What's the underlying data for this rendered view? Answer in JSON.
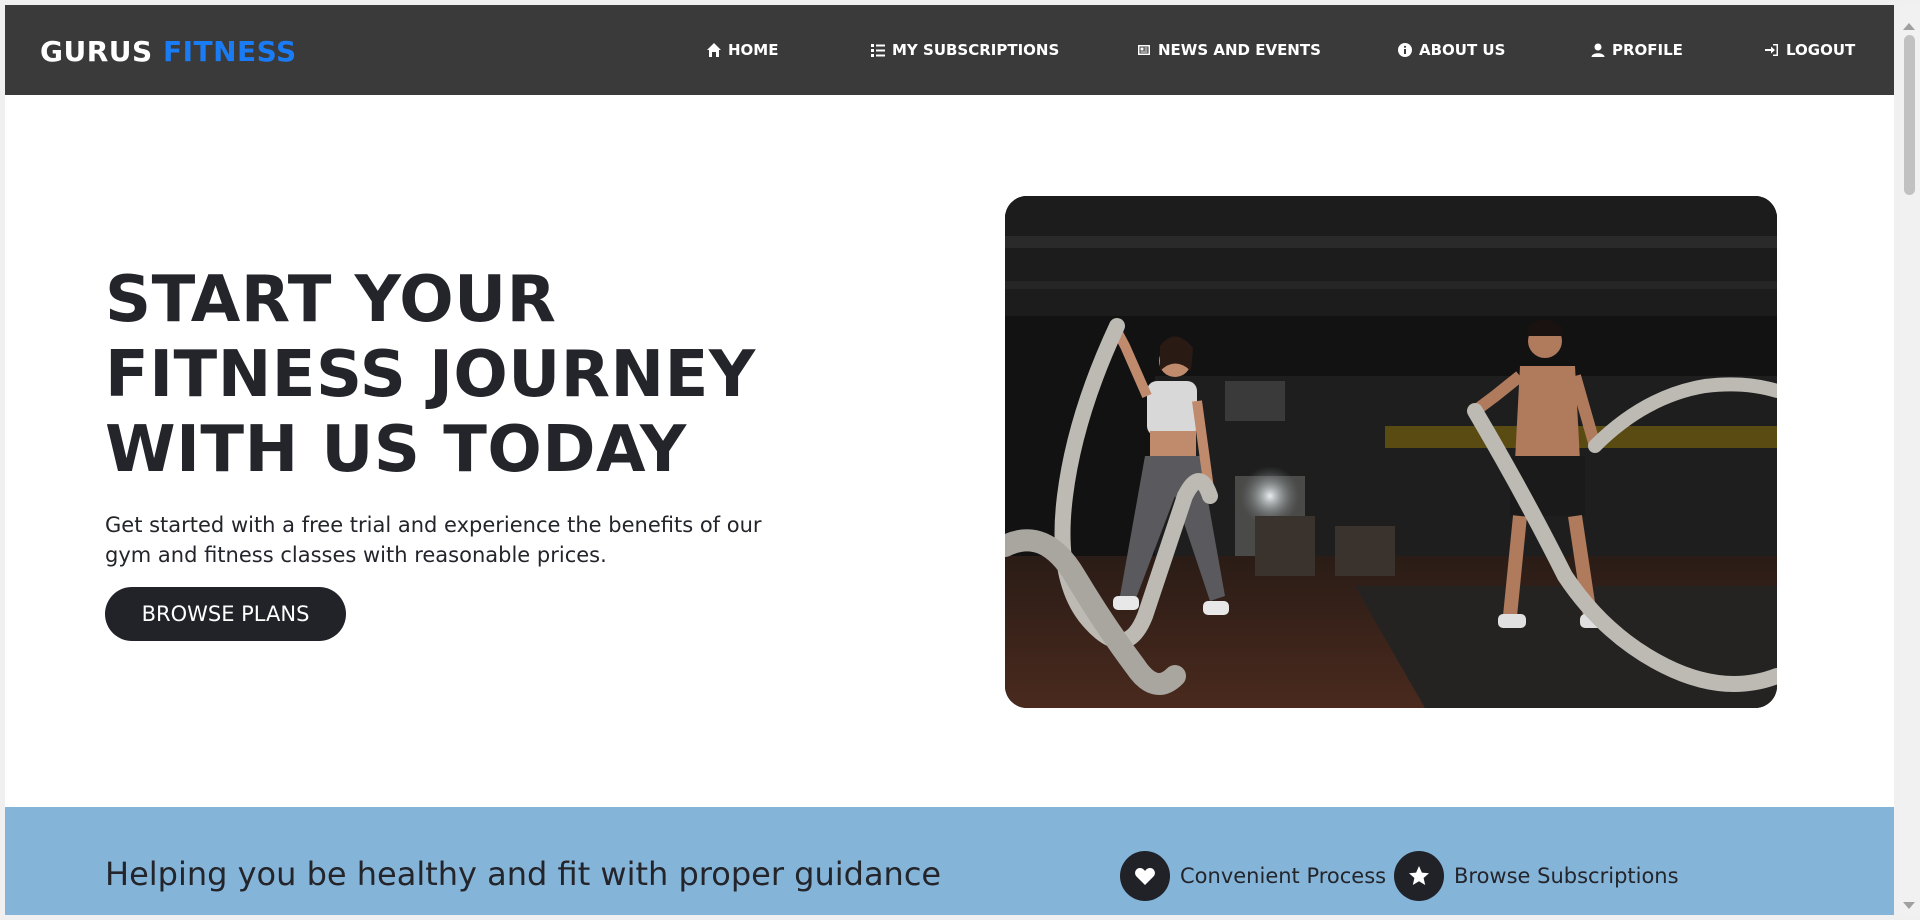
{
  "brand": {
    "name_part1": "GURUS",
    "name_part2": "FITNESS"
  },
  "nav": [
    {
      "label": "HOME",
      "icon": "home-icon"
    },
    {
      "label": "MY SUBSCRIPTIONS",
      "icon": "list-icon"
    },
    {
      "label": "NEWS AND EVENTS",
      "icon": "newspaper-icon"
    },
    {
      "label": "ABOUT US",
      "icon": "info-icon"
    },
    {
      "label": "PROFILE",
      "icon": "user-icon"
    },
    {
      "label": "LOGOUT",
      "icon": "logout-icon"
    }
  ],
  "hero": {
    "title": "START YOUR FITNESS JOURNEY WITH US TODAY",
    "subtitle": "Get started with a free trial and experience the benefits of our gym and fitness classes with reasonable prices.",
    "button": "BROWSE PLANS",
    "image_icon": "battle-ropes-photo"
  },
  "band": {
    "title": "Helping you be healthy and fit with proper guidance",
    "features": [
      {
        "label": "Convenient Process",
        "icon": "heart-icon"
      },
      {
        "label": "Browse Subscriptions",
        "icon": "star-icon"
      }
    ]
  },
  "colors": {
    "navbar": "#3a3a3a",
    "brand_accent": "#1a7cf5",
    "button": "#212329",
    "band": "#85b4d9"
  }
}
